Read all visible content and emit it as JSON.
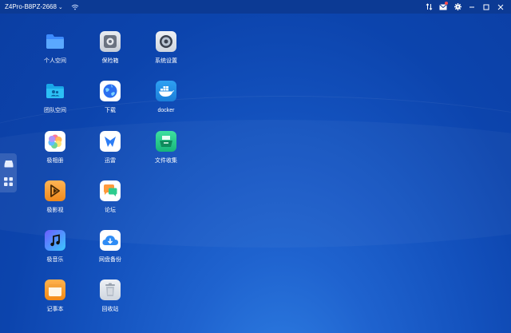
{
  "titlebar": {
    "device_name": "Z4Pro-B8PZ-2668",
    "chevron": "chevron-down-icon",
    "icons": [
      "wifi-icon",
      "transfer-icon",
      "message-icon",
      "settings-icon",
      "minimize-icon",
      "maximize-icon",
      "close-icon"
    ]
  },
  "sidebar": {
    "items": [
      "storage-icon",
      "apps-grid-icon"
    ]
  },
  "apps": [
    {
      "label": "个人空间",
      "icon": "folder-icon"
    },
    {
      "label": "保险箱",
      "icon": "safe-icon"
    },
    {
      "label": "系统设置",
      "icon": "system-settings-icon"
    },
    {
      "label": "团队空间",
      "icon": "team-folder-icon"
    },
    {
      "label": "下载",
      "icon": "download-globe-icon"
    },
    {
      "label": "docker",
      "icon": "docker-icon"
    },
    {
      "label": "极相册",
      "icon": "photos-icon"
    },
    {
      "label": "迅雷",
      "icon": "xunlei-icon"
    },
    {
      "label": "文件收集",
      "icon": "file-collect-icon"
    },
    {
      "label": "极影视",
      "icon": "video-icon"
    },
    {
      "label": "论坛",
      "icon": "forum-icon"
    },
    {
      "label": "极音乐",
      "icon": "music-icon"
    },
    {
      "label": "网盘备份",
      "icon": "cloud-backup-icon"
    },
    {
      "label": "记事本",
      "icon": "notebook-icon"
    },
    {
      "label": "回收站",
      "icon": "recycle-bin-icon"
    }
  ],
  "colors": {
    "background": "#1351bd",
    "titlebar": "#0c3a94",
    "badge": "#ff4d4f"
  }
}
